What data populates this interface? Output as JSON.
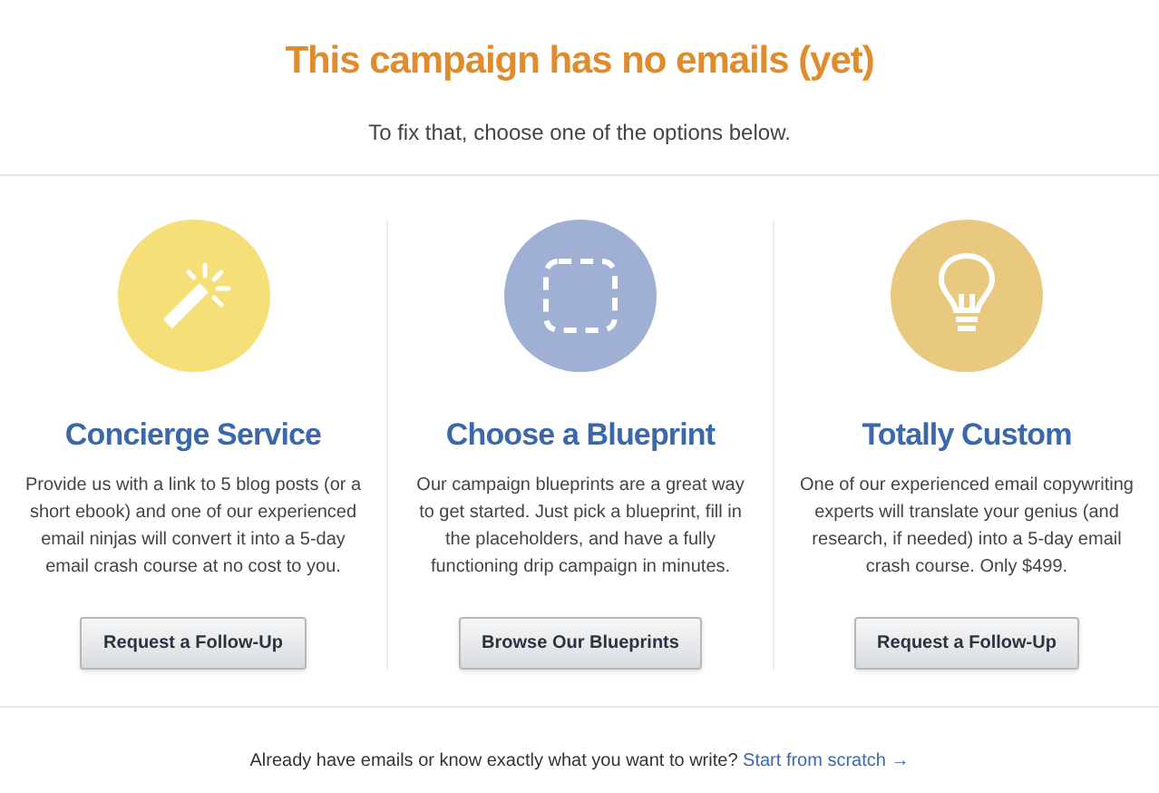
{
  "title": "This campaign has no emails (yet)",
  "subtitle": "To fix that, choose one of the options below.",
  "options": [
    {
      "kind": "wand",
      "color": "#f6df78",
      "heading": "Concierge Service",
      "description": "Provide us with a link to 5 blog posts (or a short ebook) and one of our experienced email ninjas will convert it into a 5-day email crash course at no cost to you.",
      "button": "Request a Follow-Up"
    },
    {
      "kind": "blueprint",
      "color": "#a0b0d5",
      "heading": "Choose a Blueprint",
      "description": "Our campaign blueprints are a great way to get started. Just pick a blueprint, fill in the placeholders, and have a fully functioning drip campaign in minutes.",
      "button": "Browse Our Blueprints"
    },
    {
      "kind": "bulb",
      "color": "#e9c87f",
      "heading": "Totally Custom",
      "description": "One of our experienced email copywriting experts will translate your genius (and research, if needed) into a 5-day email crash course. Only $499.",
      "button": "Request a Follow-Up"
    }
  ],
  "footer": {
    "text": "Already have emails or know exactly what you want to write?",
    "link": "Start from scratch →"
  }
}
